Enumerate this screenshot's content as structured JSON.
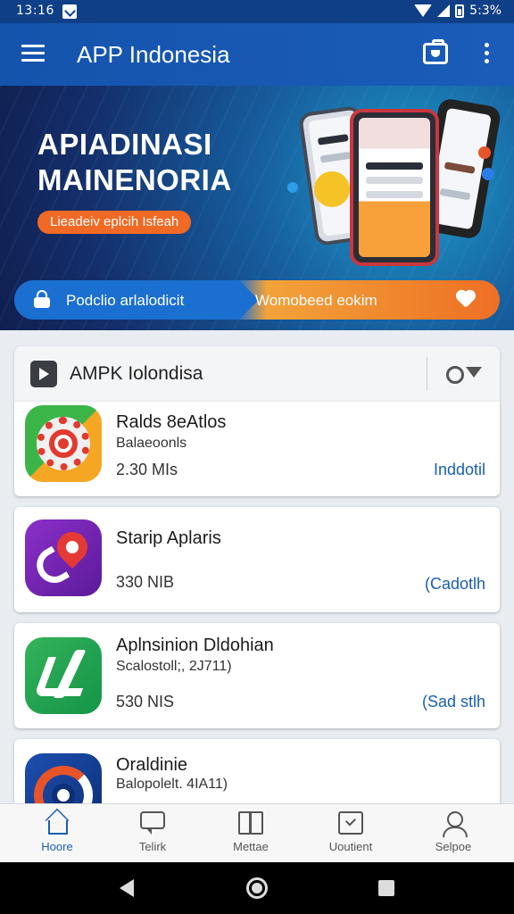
{
  "status_bar": {
    "time": "13:16",
    "battery": "5:3%"
  },
  "app_bar": {
    "title": "APP Indonesia"
  },
  "banner": {
    "headline_line1": "APIADINASI",
    "headline_line2": "MAINENORIA",
    "tagline": "Lieadeiv eplcih Isfeah",
    "cta_left": "Podclio arlalodicit",
    "cta_right": "Womobeed eokim"
  },
  "list": {
    "title": "AMPK Iolondisa",
    "apps": [
      {
        "name": "Ralds 8eAtlos",
        "subtitle": "Balaeoonls",
        "size": "2.30 MIs",
        "action": "Inddotil",
        "icon": "target-gear-icon"
      },
      {
        "name": "Starip Aplaris",
        "subtitle": "",
        "size": "330 NIB",
        "action": "(Cadotlh",
        "icon": "phone-pin-icon"
      },
      {
        "name": "Aplnsinion Dldohian",
        "subtitle": "Scalostoll;, 2J711)",
        "size": "530 NIS",
        "action": "(Sad stlh",
        "icon": "checkmark-icon"
      },
      {
        "name": "Oraldinie",
        "subtitle": "Balopolelt. 4IA11)",
        "size": "",
        "action": "",
        "icon": "compass-ring-icon"
      }
    ]
  },
  "bottom_nav": [
    {
      "label": "Hoore",
      "icon": "home-icon",
      "active": true
    },
    {
      "label": "Telirk",
      "icon": "chat-icon",
      "active": false
    },
    {
      "label": "Mettae",
      "icon": "book-icon",
      "active": false
    },
    {
      "label": "Uoutient",
      "icon": "update-icon",
      "active": false
    },
    {
      "label": "Selpoe",
      "icon": "person-icon",
      "active": false
    }
  ],
  "colors": {
    "app_bar": "#1554ad",
    "accent_orange": "#f06a25",
    "link_blue": "#1b5fb0"
  }
}
